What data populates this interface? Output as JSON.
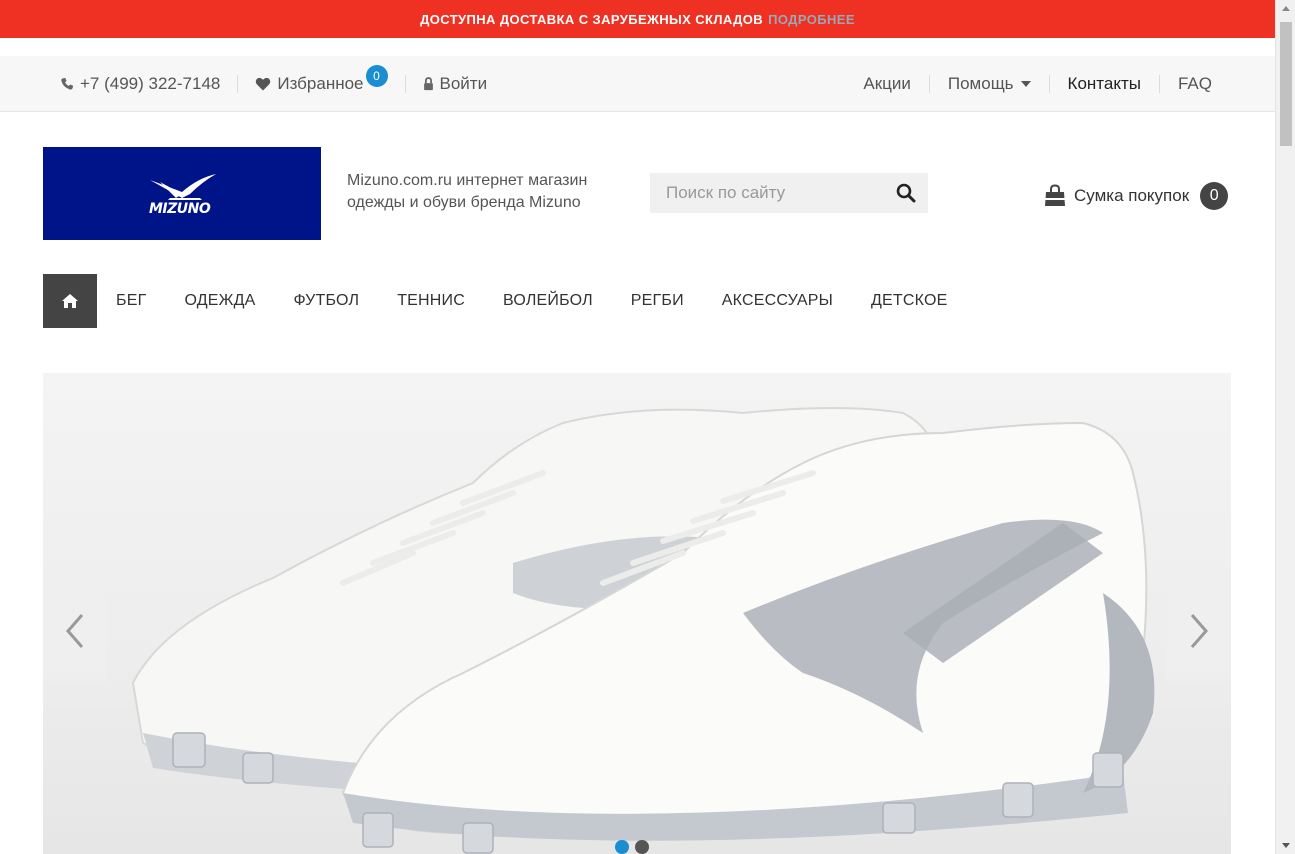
{
  "promo": {
    "text": "Доступна доставка с зарубежных складов",
    "more_label": "Подробнее"
  },
  "topbar": {
    "phone": "+7 (499) 322-7148",
    "favorites_label": "Избранное",
    "favorites_count": "0",
    "login_label": "Войти",
    "right_links": {
      "promo": "Акции",
      "help": "Помощь",
      "contacts": "Контакты",
      "faq": "FAQ"
    }
  },
  "header": {
    "tagline": "Mizuno.com.ru интернет магазин одежды и обуви бренда Mizuno",
    "search_placeholder": "Поиск по сайту",
    "cart_label": "Сумка покупок",
    "cart_count": "0"
  },
  "nav": {
    "items": [
      {
        "label": "Бег"
      },
      {
        "label": "Одежда"
      },
      {
        "label": "Футбол"
      },
      {
        "label": "Теннис"
      },
      {
        "label": "Волейбол"
      },
      {
        "label": "Регби"
      },
      {
        "label": "Аксессуары"
      },
      {
        "label": "Детское"
      }
    ]
  },
  "slider": {
    "slides_total": 2,
    "active_slide": 1
  },
  "colors": {
    "promo_bg": "#ef3124",
    "brand_blue": "#001489",
    "accent": "#1a8ed1",
    "dark": "#444444"
  },
  "icons": [
    "phone-icon",
    "heart-icon",
    "lock-icon",
    "search-icon",
    "bag-icon",
    "home-icon",
    "chevron-left-icon",
    "chevron-right-icon"
  ]
}
